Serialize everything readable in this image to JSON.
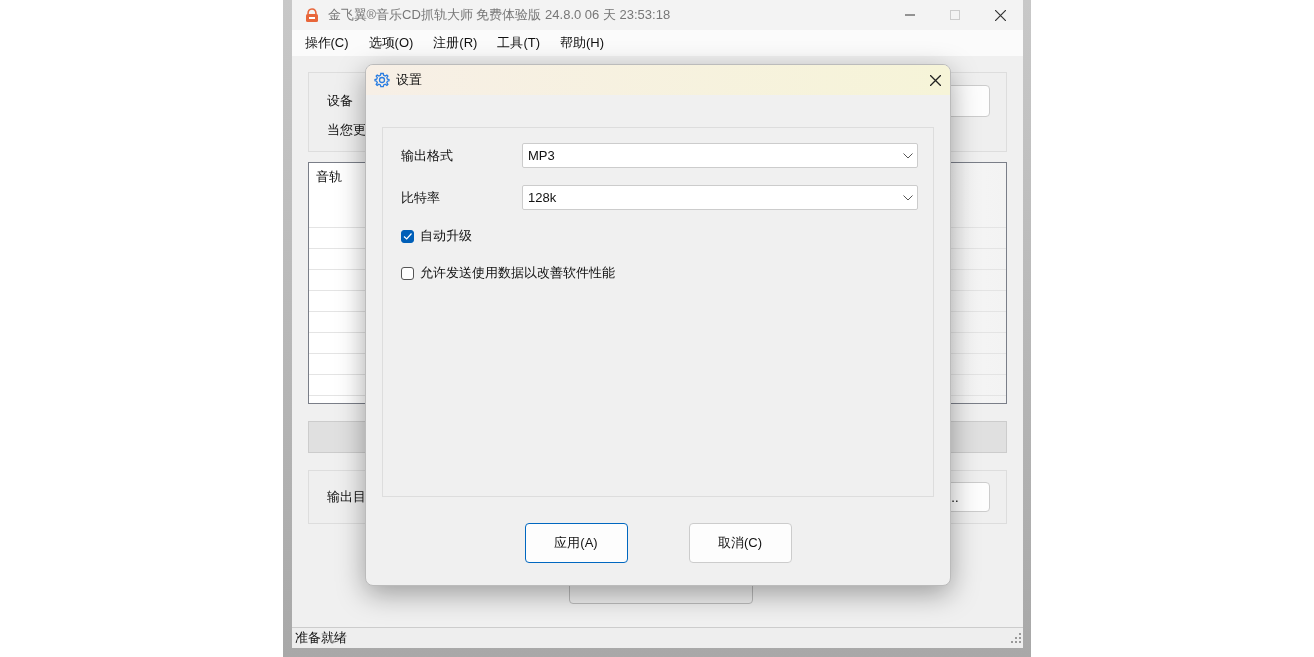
{
  "main_window": {
    "title": "金飞翼®音乐CD抓轨大师 免费体验版 24.8.0 06 天 23:53:18",
    "menu": [
      {
        "label": "操作(C)"
      },
      {
        "label": "选项(O)"
      },
      {
        "label": "注册(R)"
      },
      {
        "label": "工具(T)"
      },
      {
        "label": "帮助(H)"
      }
    ],
    "device_group": {
      "label": "设备",
      "note": "当您更"
    },
    "track_list": {
      "column": "音轨"
    },
    "output_group": {
      "label": "输出目",
      "button": ".."
    },
    "status_bar": "准备就绪"
  },
  "dialog": {
    "title": "设置",
    "fields": [
      {
        "label": "输出格式",
        "value": "MP3"
      },
      {
        "label": "比特率",
        "value": "128k"
      }
    ],
    "options": [
      {
        "label": "自动升级",
        "checked": true
      },
      {
        "label": "允许发送使用数据以改善软件性能",
        "checked": false
      }
    ],
    "buttons": [
      {
        "label": "应用(A)",
        "default": true
      },
      {
        "label": "取消(C)",
        "default": false
      }
    ]
  }
}
